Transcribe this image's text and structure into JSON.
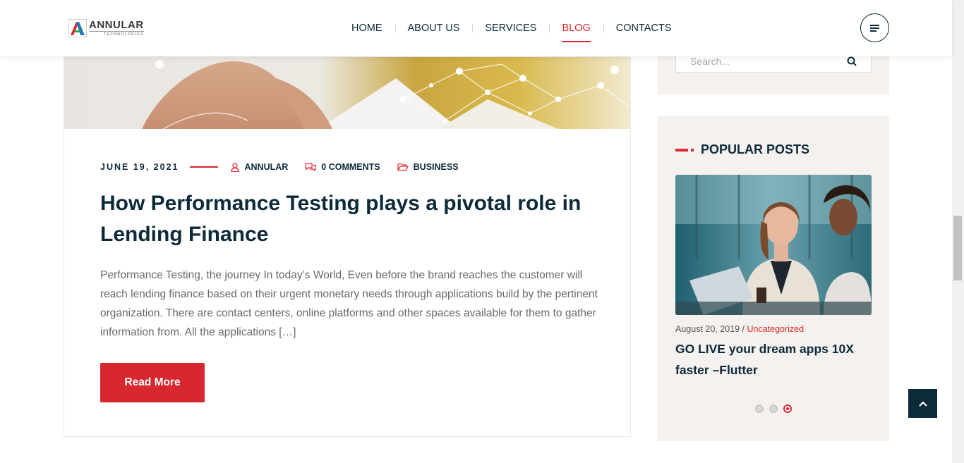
{
  "header": {
    "logo": {
      "word": "ANNULAR",
      "sub": "TECHNOLOGIES"
    },
    "nav": [
      {
        "label": "HOME",
        "active": false
      },
      {
        "label": "ABOUT US",
        "active": false
      },
      {
        "label": "SERVICES",
        "active": false
      },
      {
        "label": "BLOG",
        "active": true
      },
      {
        "label": "CONTACTS",
        "active": false
      }
    ],
    "menu_icon": "hamburger-icon"
  },
  "post": {
    "date": "JUNE 19, 2021",
    "author": "ANNULAR",
    "comments": "0 COMMENTS",
    "category": "BUSINESS",
    "title": "How Performance Testing plays a pivotal role in Lending Finance",
    "excerpt": "Performance Testing, the journey In today’s World, Even before the brand reaches the customer will reach lending finance based on their urgent monetary needs through applications build by the pertinent organization. There are contact centers, online platforms and other spaces available for them to gather information from. All the applications […]",
    "read_more": "Read More"
  },
  "sidebar": {
    "search": {
      "placeholder": "Search...",
      "icon": "search-icon"
    },
    "popular": {
      "heading": "POPULAR POSTS",
      "item": {
        "date": "August 20, 2019",
        "separator": " / ",
        "category": "Uncategorized",
        "title": "GO LIVE your dream apps 10X faster –Flutter"
      },
      "carousel": {
        "dots": 3,
        "active_index": 2
      }
    }
  },
  "colors": {
    "accent": "#e0262f",
    "navy": "#0d2a3a",
    "sidebar_bg": "#f4f1ee"
  }
}
